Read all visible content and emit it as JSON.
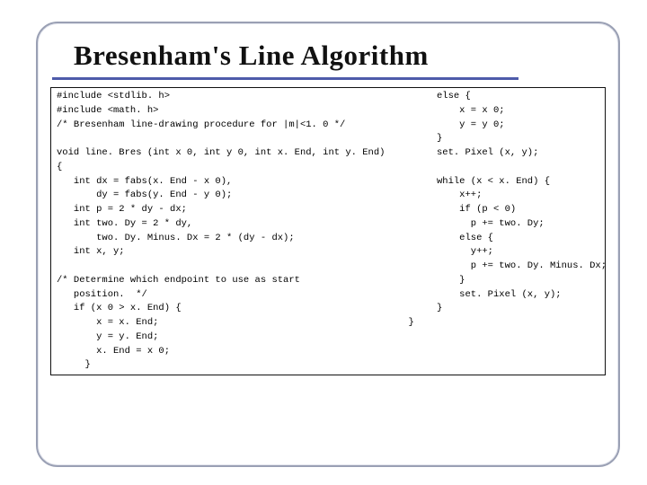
{
  "title": "Bresenham's Line Algorithm",
  "code_left": "#include <stdlib. h>\n#include <math. h>\n/* Bresenham line-drawing procedure for |m|<1. 0 */\n\nvoid line. Bres (int x 0, int y 0, int x. End, int y. End)\n{\n   int dx = fabs(x. End - x 0),\n       dy = fabs(y. End - y 0);\n   int p = 2 * dy - dx;\n   int two. Dy = 2 * dy,\n       two. Dy. Minus. Dx = 2 * (dy - dx);\n   int x, y;\n\n/* Determine which endpoint to use as start\n   position.  */\n   if (x 0 > x. End) {\n       x = x. End;\n       y = y. End;\n       x. End = x 0;\n     }",
  "code_right": "     else {\n         x = x 0;\n         y = y 0;\n     }\n     set. Pixel (x, y);\n\n     while (x < x. End) {\n         x++;\n         if (p < 0)\n           p += two. Dy;\n         else {\n           y++;\n           p += two. Dy. Minus. Dx;\n         }\n         set. Pixel (x, y);\n     }\n}"
}
